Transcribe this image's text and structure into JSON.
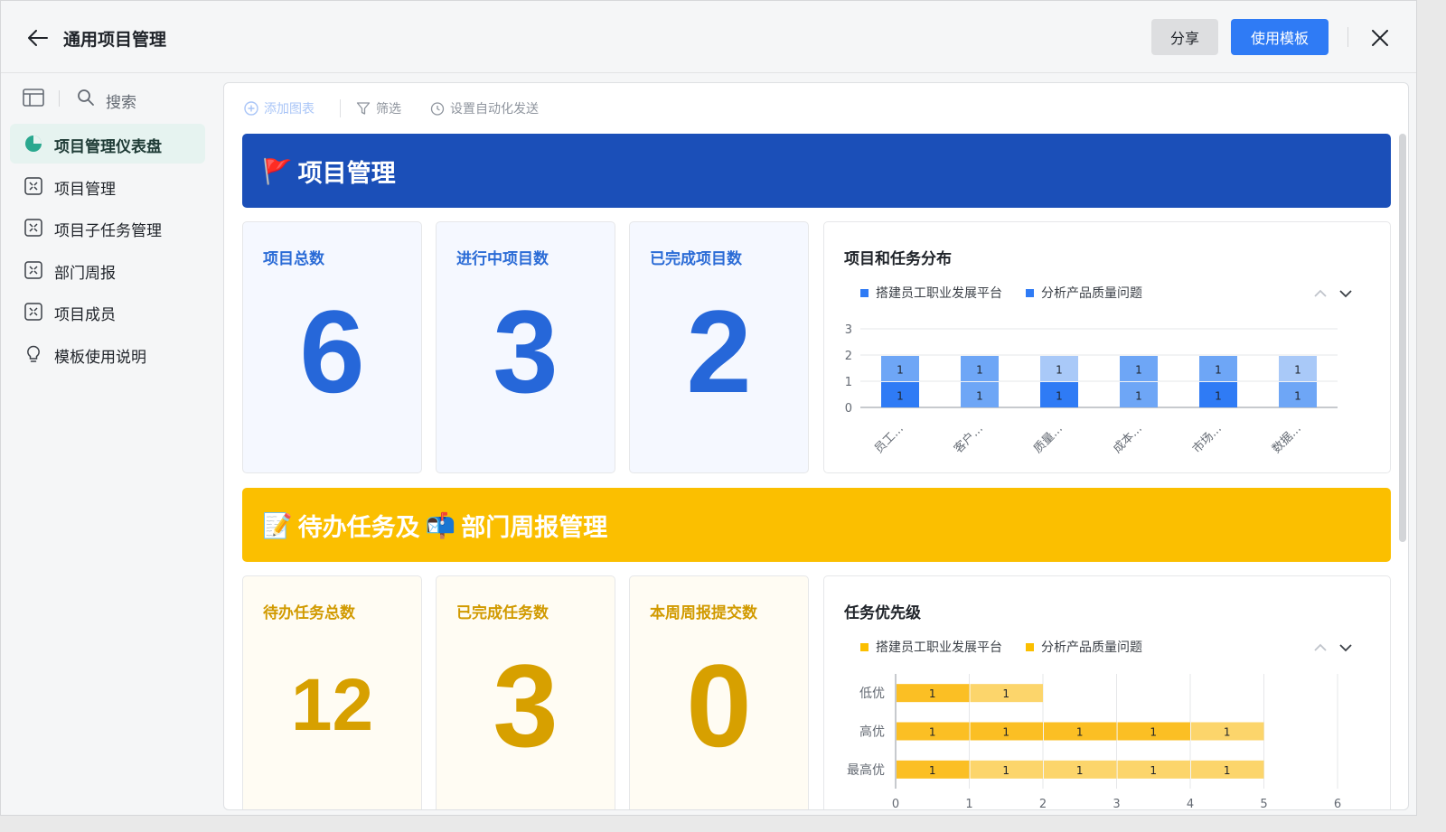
{
  "header": {
    "title": "通用项目管理",
    "share_label": "分享",
    "use_template_label": "使用模板"
  },
  "sidebar": {
    "search_label": "搜索",
    "items": [
      {
        "label": "项目管理仪表盘",
        "icon": "pie-chart-icon",
        "active": true
      },
      {
        "label": "项目管理",
        "icon": "table-icon",
        "active": false
      },
      {
        "label": "项目子任务管理",
        "icon": "table-icon",
        "active": false
      },
      {
        "label": "部门周报",
        "icon": "table-icon",
        "active": false
      },
      {
        "label": "项目成员",
        "icon": "table-icon",
        "active": false
      },
      {
        "label": "模板使用说明",
        "icon": "lightbulb-icon",
        "active": false
      }
    ]
  },
  "toolbar": {
    "add_chart_label": "添加图表",
    "filter_label": "筛选",
    "auto_send_label": "设置自动化发送"
  },
  "sections": {
    "project": {
      "banner_emoji": "🚩",
      "banner_title": "项目管理",
      "stats": [
        {
          "title": "项目总数",
          "value": "6"
        },
        {
          "title": "进行中项目数",
          "value": "3"
        },
        {
          "title": "已完成项目数",
          "value": "2"
        }
      ]
    },
    "tasks": {
      "banner_prefix_emoji": "📝",
      "banner_text_1": "待办任务及",
      "banner_mid_emoji": "📬",
      "banner_text_2": "部门周报管理",
      "stats": [
        {
          "title": "待办任务总数",
          "value": "12"
        },
        {
          "title": "已完成任务数",
          "value": "3"
        },
        {
          "title": "本周周报提交数",
          "value": "0"
        }
      ]
    }
  },
  "colors": {
    "blue_banner": "#1b4fb8",
    "yellow_banner": "#fbbf00",
    "primary_button": "#2f7bf5",
    "sidebar_active": "#e6f3f0"
  },
  "chart_data": [
    {
      "type": "bar",
      "stacked": true,
      "title": "项目和任务分布",
      "categories": [
        "员工...",
        "客户...",
        "质量...",
        "成本...",
        "市场...",
        "数据..."
      ],
      "legend": [
        "搭建员工职业发展平台",
        "分析产品质量问题"
      ],
      "legend_color": "#2f7bf5",
      "segment_colors": [
        [
          "#2f7bf5",
          "#6ea6f6"
        ],
        [
          "#6ea6f6",
          "#6ea6f6"
        ],
        [
          "#2f7bf5",
          "#a9c9f8"
        ],
        [
          "#6ea6f6",
          "#6ea6f6"
        ],
        [
          "#2f7bf5",
          "#6ea6f6"
        ],
        [
          "#6ea6f6",
          "#a9c9f8"
        ]
      ],
      "series": [
        {
          "values": [
            1,
            1,
            1,
            1,
            1,
            1
          ]
        },
        {
          "values": [
            1,
            1,
            1,
            1,
            1,
            1
          ]
        }
      ],
      "ylim": [
        0,
        3
      ],
      "yticks": [
        0,
        1,
        2,
        3
      ],
      "grid": true,
      "legend_position": "top-left"
    },
    {
      "type": "bar",
      "orientation": "horizontal",
      "stacked": true,
      "title": "任务优先级",
      "categories": [
        "低优",
        "高优",
        "最高优"
      ],
      "legend": [
        "搭建员工职业发展平台",
        "分析产品质量问题"
      ],
      "legend_color": "#fbbf00",
      "segments": [
        {
          "values": [
            1,
            1
          ],
          "colors": [
            "#fbbf24",
            "#fcd56b"
          ]
        },
        {
          "values": [
            1,
            1,
            1,
            1,
            1
          ],
          "colors": [
            "#fbbf24",
            "#fbbf24",
            "#fbbf24",
            "#fbbf24",
            "#fcd56b"
          ]
        },
        {
          "values": [
            1,
            1,
            1,
            1,
            1
          ],
          "colors": [
            "#fbbf24",
            "#fcd56b",
            "#fcd56b",
            "#fcd56b",
            "#fcd56b"
          ]
        }
      ],
      "xlim": [
        0,
        6
      ],
      "xticks": [
        0,
        1,
        2,
        3,
        4,
        5,
        6
      ],
      "grid": true,
      "legend_position": "top-left"
    }
  ]
}
